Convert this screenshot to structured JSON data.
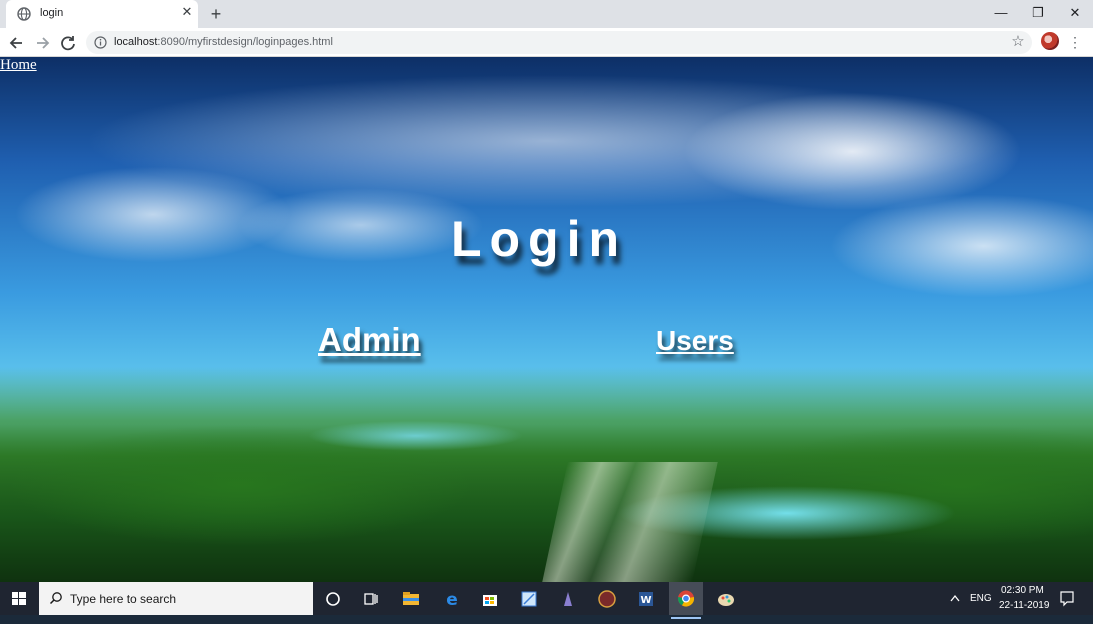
{
  "browser": {
    "tab": {
      "title": "login",
      "close": "✕"
    },
    "new_tab": "+",
    "window": {
      "minimize": "—",
      "restore": "❐",
      "close": "✕"
    },
    "address": {
      "host": "localhost",
      "path": ":8090/myfirstdesign/loginpages.html"
    }
  },
  "page": {
    "home_link": "Home",
    "title": "Login",
    "links": {
      "admin": "Admin",
      "users": "Users"
    }
  },
  "taskbar": {
    "search_placeholder": "Type here to search",
    "tray": {
      "language": "ENG",
      "time": "02:30 PM",
      "date": "22-11-2019"
    }
  }
}
